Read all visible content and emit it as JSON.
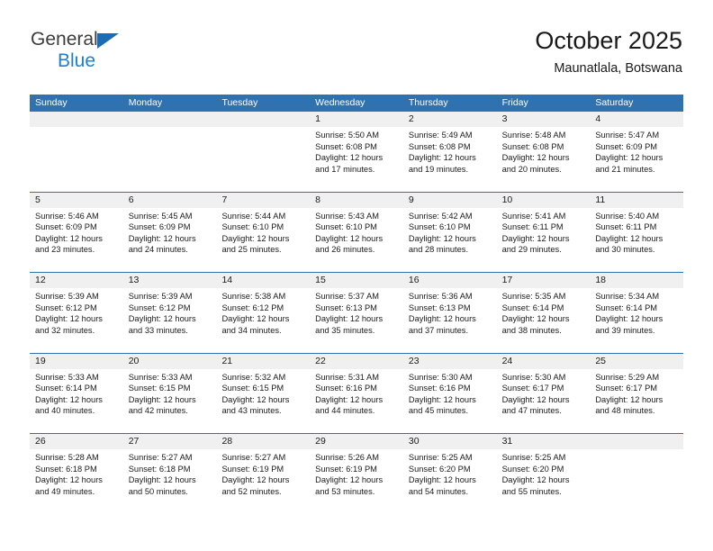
{
  "brand": {
    "line1": "General",
    "line2": "Blue",
    "logo_blue": "#1b7fd4",
    "logo_triangle": "#1b6cb5"
  },
  "header": {
    "title": "October 2025",
    "subtitle": "Maunatlala, Botswana"
  },
  "theme": {
    "header_blue": "#3071b0",
    "daynum_bg": "#f0f0f0"
  },
  "weekday_headers": [
    "Sunday",
    "Monday",
    "Tuesday",
    "Wednesday",
    "Thursday",
    "Friday",
    "Saturday"
  ],
  "labels": {
    "sunrise": "Sunrise:",
    "sunset": "Sunset:",
    "daylight": "Daylight:"
  },
  "weeks": [
    [
      {
        "day": "",
        "empty": true
      },
      {
        "day": "",
        "empty": true
      },
      {
        "day": "",
        "empty": true
      },
      {
        "day": "1",
        "sunrise": "Sunrise: 5:50 AM",
        "sunset": "Sunset: 6:08 PM",
        "daylight1": "Daylight: 12 hours",
        "daylight2": "and 17 minutes."
      },
      {
        "day": "2",
        "sunrise": "Sunrise: 5:49 AM",
        "sunset": "Sunset: 6:08 PM",
        "daylight1": "Daylight: 12 hours",
        "daylight2": "and 19 minutes."
      },
      {
        "day": "3",
        "sunrise": "Sunrise: 5:48 AM",
        "sunset": "Sunset: 6:08 PM",
        "daylight1": "Daylight: 12 hours",
        "daylight2": "and 20 minutes."
      },
      {
        "day": "4",
        "sunrise": "Sunrise: 5:47 AM",
        "sunset": "Sunset: 6:09 PM",
        "daylight1": "Daylight: 12 hours",
        "daylight2": "and 21 minutes."
      }
    ],
    [
      {
        "day": "5",
        "sunrise": "Sunrise: 5:46 AM",
        "sunset": "Sunset: 6:09 PM",
        "daylight1": "Daylight: 12 hours",
        "daylight2": "and 23 minutes."
      },
      {
        "day": "6",
        "sunrise": "Sunrise: 5:45 AM",
        "sunset": "Sunset: 6:09 PM",
        "daylight1": "Daylight: 12 hours",
        "daylight2": "and 24 minutes."
      },
      {
        "day": "7",
        "sunrise": "Sunrise: 5:44 AM",
        "sunset": "Sunset: 6:10 PM",
        "daylight1": "Daylight: 12 hours",
        "daylight2": "and 25 minutes."
      },
      {
        "day": "8",
        "sunrise": "Sunrise: 5:43 AM",
        "sunset": "Sunset: 6:10 PM",
        "daylight1": "Daylight: 12 hours",
        "daylight2": "and 26 minutes."
      },
      {
        "day": "9",
        "sunrise": "Sunrise: 5:42 AM",
        "sunset": "Sunset: 6:10 PM",
        "daylight1": "Daylight: 12 hours",
        "daylight2": "and 28 minutes."
      },
      {
        "day": "10",
        "sunrise": "Sunrise: 5:41 AM",
        "sunset": "Sunset: 6:11 PM",
        "daylight1": "Daylight: 12 hours",
        "daylight2": "and 29 minutes."
      },
      {
        "day": "11",
        "sunrise": "Sunrise: 5:40 AM",
        "sunset": "Sunset: 6:11 PM",
        "daylight1": "Daylight: 12 hours",
        "daylight2": "and 30 minutes."
      }
    ],
    [
      {
        "day": "12",
        "sunrise": "Sunrise: 5:39 AM",
        "sunset": "Sunset: 6:12 PM",
        "daylight1": "Daylight: 12 hours",
        "daylight2": "and 32 minutes."
      },
      {
        "day": "13",
        "sunrise": "Sunrise: 5:39 AM",
        "sunset": "Sunset: 6:12 PM",
        "daylight1": "Daylight: 12 hours",
        "daylight2": "and 33 minutes."
      },
      {
        "day": "14",
        "sunrise": "Sunrise: 5:38 AM",
        "sunset": "Sunset: 6:12 PM",
        "daylight1": "Daylight: 12 hours",
        "daylight2": "and 34 minutes."
      },
      {
        "day": "15",
        "sunrise": "Sunrise: 5:37 AM",
        "sunset": "Sunset: 6:13 PM",
        "daylight1": "Daylight: 12 hours",
        "daylight2": "and 35 minutes."
      },
      {
        "day": "16",
        "sunrise": "Sunrise: 5:36 AM",
        "sunset": "Sunset: 6:13 PM",
        "daylight1": "Daylight: 12 hours",
        "daylight2": "and 37 minutes."
      },
      {
        "day": "17",
        "sunrise": "Sunrise: 5:35 AM",
        "sunset": "Sunset: 6:14 PM",
        "daylight1": "Daylight: 12 hours",
        "daylight2": "and 38 minutes."
      },
      {
        "day": "18",
        "sunrise": "Sunrise: 5:34 AM",
        "sunset": "Sunset: 6:14 PM",
        "daylight1": "Daylight: 12 hours",
        "daylight2": "and 39 minutes."
      }
    ],
    [
      {
        "day": "19",
        "sunrise": "Sunrise: 5:33 AM",
        "sunset": "Sunset: 6:14 PM",
        "daylight1": "Daylight: 12 hours",
        "daylight2": "and 40 minutes."
      },
      {
        "day": "20",
        "sunrise": "Sunrise: 5:33 AM",
        "sunset": "Sunset: 6:15 PM",
        "daylight1": "Daylight: 12 hours",
        "daylight2": "and 42 minutes."
      },
      {
        "day": "21",
        "sunrise": "Sunrise: 5:32 AM",
        "sunset": "Sunset: 6:15 PM",
        "daylight1": "Daylight: 12 hours",
        "daylight2": "and 43 minutes."
      },
      {
        "day": "22",
        "sunrise": "Sunrise: 5:31 AM",
        "sunset": "Sunset: 6:16 PM",
        "daylight1": "Daylight: 12 hours",
        "daylight2": "and 44 minutes."
      },
      {
        "day": "23",
        "sunrise": "Sunrise: 5:30 AM",
        "sunset": "Sunset: 6:16 PM",
        "daylight1": "Daylight: 12 hours",
        "daylight2": "and 45 minutes."
      },
      {
        "day": "24",
        "sunrise": "Sunrise: 5:30 AM",
        "sunset": "Sunset: 6:17 PM",
        "daylight1": "Daylight: 12 hours",
        "daylight2": "and 47 minutes."
      },
      {
        "day": "25",
        "sunrise": "Sunrise: 5:29 AM",
        "sunset": "Sunset: 6:17 PM",
        "daylight1": "Daylight: 12 hours",
        "daylight2": "and 48 minutes."
      }
    ],
    [
      {
        "day": "26",
        "sunrise": "Sunrise: 5:28 AM",
        "sunset": "Sunset: 6:18 PM",
        "daylight1": "Daylight: 12 hours",
        "daylight2": "and 49 minutes."
      },
      {
        "day": "27",
        "sunrise": "Sunrise: 5:27 AM",
        "sunset": "Sunset: 6:18 PM",
        "daylight1": "Daylight: 12 hours",
        "daylight2": "and 50 minutes."
      },
      {
        "day": "28",
        "sunrise": "Sunrise: 5:27 AM",
        "sunset": "Sunset: 6:19 PM",
        "daylight1": "Daylight: 12 hours",
        "daylight2": "and 52 minutes."
      },
      {
        "day": "29",
        "sunrise": "Sunrise: 5:26 AM",
        "sunset": "Sunset: 6:19 PM",
        "daylight1": "Daylight: 12 hours",
        "daylight2": "and 53 minutes."
      },
      {
        "day": "30",
        "sunrise": "Sunrise: 5:25 AM",
        "sunset": "Sunset: 6:20 PM",
        "daylight1": "Daylight: 12 hours",
        "daylight2": "and 54 minutes."
      },
      {
        "day": "31",
        "sunrise": "Sunrise: 5:25 AM",
        "sunset": "Sunset: 6:20 PM",
        "daylight1": "Daylight: 12 hours",
        "daylight2": "and 55 minutes."
      },
      {
        "day": "",
        "empty": true
      }
    ]
  ]
}
